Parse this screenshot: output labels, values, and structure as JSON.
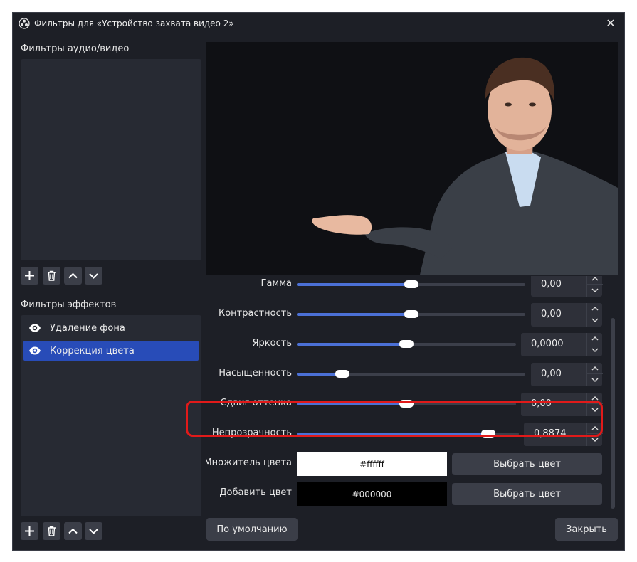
{
  "window": {
    "title": "Фильтры для «Устройство захвата видео 2»",
    "close_glyph": "✕"
  },
  "audio_video": {
    "label": "Фильтры аудио/видео"
  },
  "effects": {
    "label": "Фильтры эффектов",
    "items": [
      {
        "label": "Удаление фона",
        "icon": "eye-icon",
        "selected": false
      },
      {
        "label": "Коррекция цвета",
        "icon": "eye-icon",
        "selected": true
      }
    ]
  },
  "properties": {
    "gamma": {
      "label": "Гамма",
      "value": "0,00",
      "level": 0.5
    },
    "contrast": {
      "label": "Контрастность",
      "value": "0,00",
      "level": 0.5
    },
    "brightness": {
      "label": "Яркость",
      "value": "0,0000",
      "level": 0.5
    },
    "saturation": {
      "label": "Насыщенность",
      "value": "0,00",
      "level": 0.18
    },
    "hue_shift": {
      "label": "Сдвиг оттенка",
      "value": "0,00",
      "level": 0.5
    },
    "opacity": {
      "label": "Непрозрачность",
      "value": "0,8874",
      "level": 0.8874
    },
    "color_multiplier": {
      "label": "Множитель цвета",
      "hex": "#ffffff",
      "button": "Выбрать цвет"
    },
    "color_add": {
      "label": "Добавить цвет",
      "hex": "#000000",
      "button": "Выбрать цвет"
    }
  },
  "footer": {
    "defaults_button": "По умолчанию",
    "close_button": "Закрыть"
  },
  "colors": {
    "accent": "#284cb8",
    "slider_fill": "#4b70d6",
    "highlight": "#e11a1a"
  }
}
